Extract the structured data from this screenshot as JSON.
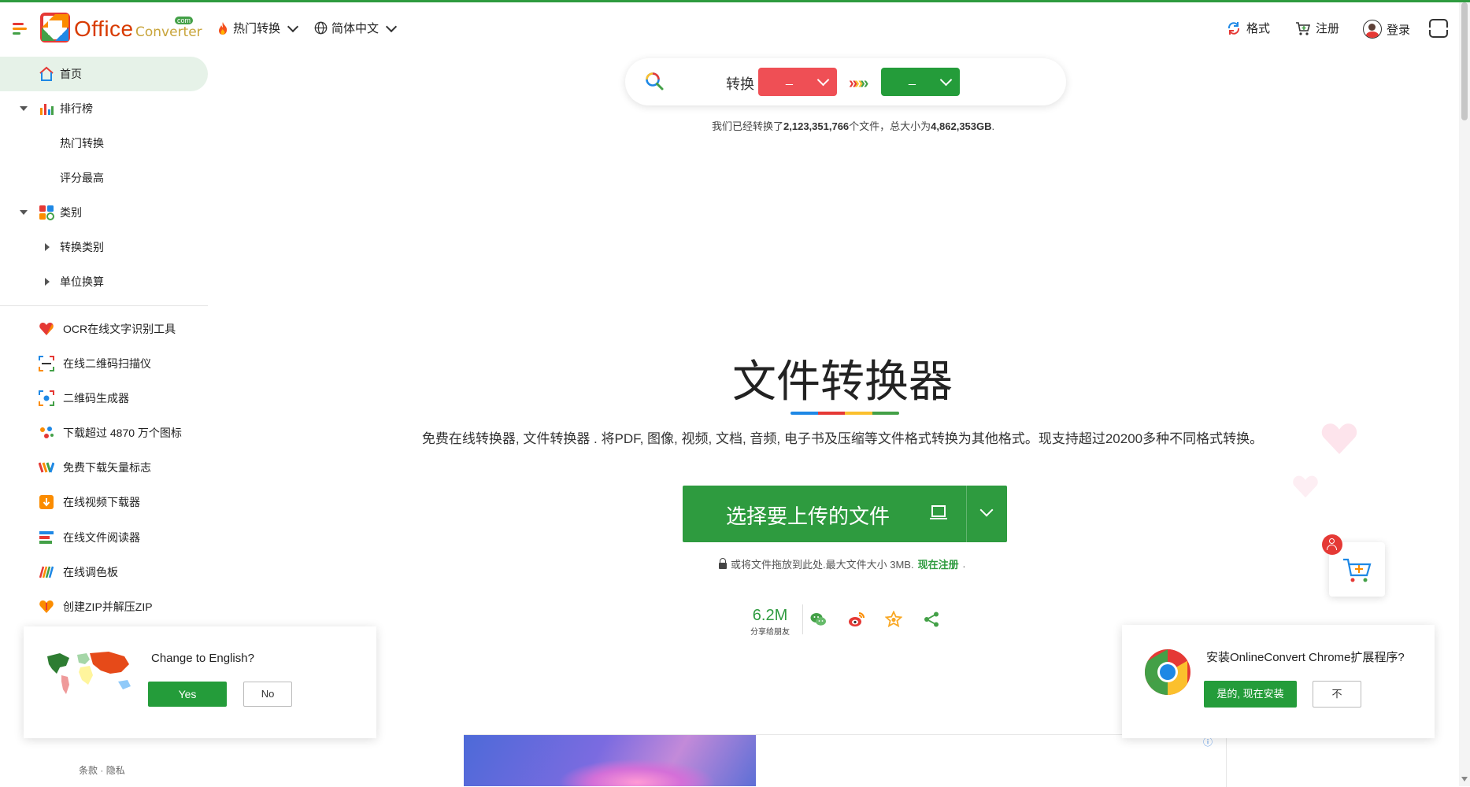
{
  "header": {
    "logo_text": "Office",
    "logo_sub": "Converter",
    "logo_com": "com",
    "hot_convert": "热门转换",
    "language": "简体中文",
    "formats": "格式",
    "register": "注册",
    "login": "登录"
  },
  "sidebar": {
    "home": "首页",
    "ranking": "排行榜",
    "hot_convert": "热门转换",
    "top_rated": "评分最高",
    "category": "类别",
    "convert_category": "转换类别",
    "unit_convert": "单位换算",
    "tools": [
      {
        "label": "OCR在线文字识别工具",
        "icon": "heart-icon"
      },
      {
        "label": "在线二维码扫描仪",
        "icon": "qr-scan-icon"
      },
      {
        "label": "二维码生成器",
        "icon": "qr-generate-icon"
      },
      {
        "label": "下载超过 4870 万个图标",
        "icon": "dots-icon"
      },
      {
        "label": "免费下载矢量标志",
        "icon": "vector-logo-icon"
      },
      {
        "label": "在线视频下载器",
        "icon": "video-download-icon"
      },
      {
        "label": "在线文件阅读器",
        "icon": "file-reader-icon"
      },
      {
        "label": "在线调色板",
        "icon": "palette-icon"
      },
      {
        "label": "创建ZIP并解压ZIP",
        "icon": "zip-icon"
      }
    ]
  },
  "search": {
    "label": "转换",
    "from_value": "_",
    "to_value": "_"
  },
  "stats": {
    "prefix": "我们已经转换了",
    "file_count": "2,123,351,766",
    "middle": "个文件，总大小为",
    "total_size": "4,862,353GB",
    "suffix": "."
  },
  "hero": {
    "title": "文件转换器",
    "description": "免费在线转换器, 文件转换器 . 将PDF, 图像, 视频, 文档, 音频, 电子书及压缩等文件格式转换为其他格式。现支持超过20200多种不同格式转换。"
  },
  "upload": {
    "label": "选择要上传的文件",
    "hint_prefix": "或将文件拖放到此处.最大文件大小 3MB.",
    "hint_link": "现在注册",
    "hint_suffix": "."
  },
  "share": {
    "count": "6.2M",
    "count_label": "分享给朋友"
  },
  "lang_popup": {
    "question": "Change to English?",
    "yes": "Yes",
    "no": "No"
  },
  "footer": {
    "terms": "条款",
    "dot": "·",
    "privacy": "隐私"
  },
  "chrome_popup": {
    "question": "安装OnlineConvert Chrome扩展程序?",
    "install": "是的, 现在安装",
    "decline": "不"
  },
  "ad": {
    "info": "ⓘ"
  },
  "colors": {
    "brand_green": "#2e9b3f",
    "from_red": "#ef4f55",
    "to_green": "#249c3a",
    "accent_orange": "#d83b01"
  }
}
